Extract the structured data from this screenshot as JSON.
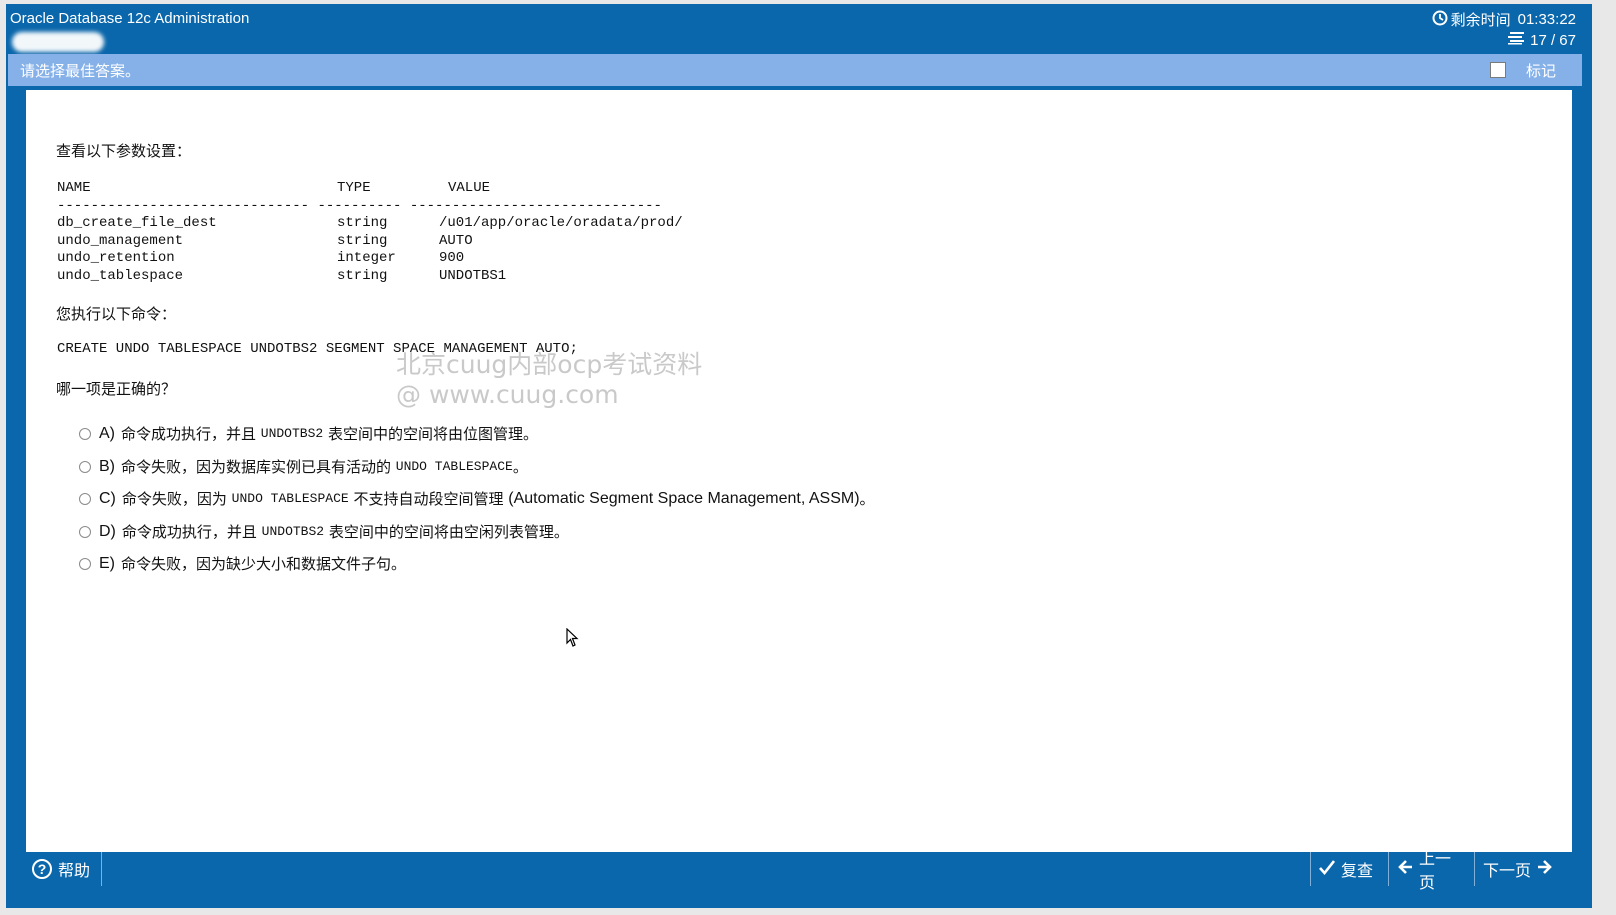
{
  "header": {
    "app_title": "Oracle Database 12c Administration",
    "timer_label": "剩余时间",
    "timer_value": "01:33:22",
    "progress": "17 / 67",
    "clock_icon": "clock-icon",
    "list_icon": "list-icon"
  },
  "instruction_bar": {
    "text": "请选择最佳答案。",
    "mark_label": "标记",
    "mark_checked": false
  },
  "question": {
    "intro": "查看以下参数设置：",
    "param_table": {
      "headers": [
        "NAME",
        "TYPE",
        "VALUE"
      ],
      "separator": "------------------------------ ---------- ------------------------------",
      "rows": [
        [
          "db_create_file_dest",
          "string",
          "/u01/app/oracle/oradata/prod/"
        ],
        [
          "undo_management",
          "string",
          "AUTO"
        ],
        [
          "undo_retention",
          "integer",
          "900"
        ],
        [
          "undo_tablespace",
          "string",
          "UNDOTBS1"
        ]
      ]
    },
    "command_intro": "您执行以下命令：",
    "command": "CREATE UNDO TABLESPACE UNDOTBS2 SEGMENT SPACE MANAGEMENT AUTO;",
    "prompt": "哪一项是正确的？",
    "options": [
      {
        "key": "A)",
        "parts": [
          {
            "t": "命令成功执行，并且 "
          },
          {
            "m": "UNDOTBS2"
          },
          {
            "t": " 表空间中的空间将由位图管理。"
          }
        ]
      },
      {
        "key": "B)",
        "parts": [
          {
            "t": "命令失败，因为数据库实例已具有活动的 "
          },
          {
            "m": "UNDO TABLESPACE"
          },
          {
            "t": "。"
          }
        ]
      },
      {
        "key": "C)",
        "parts": [
          {
            "t": "命令失败，因为 "
          },
          {
            "m": "UNDO TABLESPACE"
          },
          {
            "t": " 不支持自动段空间管理 "
          },
          {
            "s": "(Automatic Segment Space Management, ASSM)"
          },
          {
            "t": "。"
          }
        ]
      },
      {
        "key": "D)",
        "parts": [
          {
            "t": "命令成功执行，并且 "
          },
          {
            "m": "UNDOTBS2"
          },
          {
            "t": " 表空间中的空间将由空闲列表管理。"
          }
        ]
      },
      {
        "key": "E)",
        "parts": [
          {
            "t": "命令失败，因为缺少大小和数据文件子句。"
          }
        ]
      }
    ]
  },
  "watermark": {
    "line1": "北京cuug内部ocp考试资料",
    "line2": "@ www.cuug.com"
  },
  "footer": {
    "help_label": "帮助",
    "review_label": "复查",
    "prev_label": "上一页",
    "next_label": "下一页"
  },
  "colors": {
    "primary_blue": "#0b67ab",
    "instruction_bar": "#86b1e8"
  }
}
